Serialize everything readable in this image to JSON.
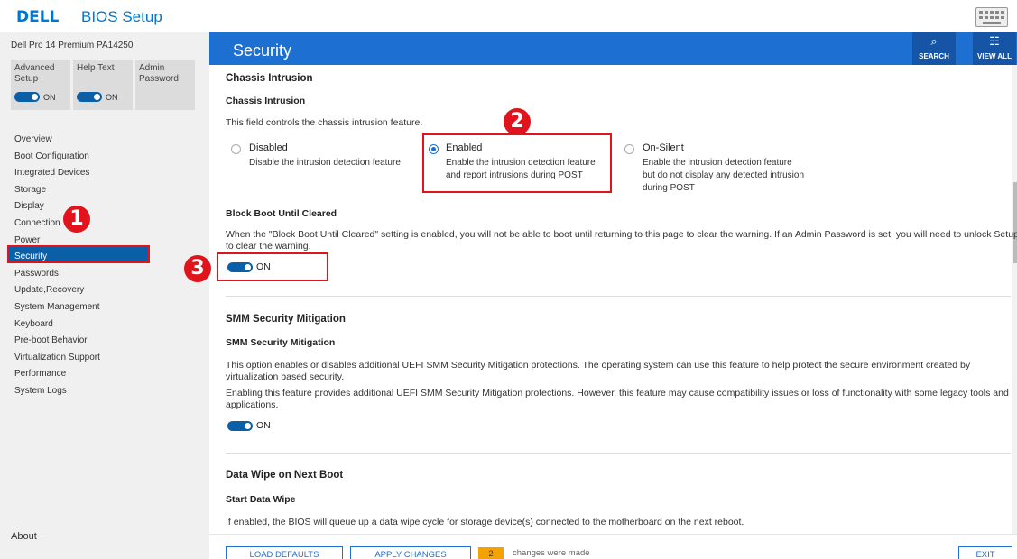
{
  "app": {
    "logo": "DELL",
    "title": "BIOS Setup"
  },
  "sidebar": {
    "model": "Dell Pro 14 Premium PA14250",
    "options": [
      {
        "label": "Advanced Setup",
        "toggle": "ON"
      },
      {
        "label": "Help Text",
        "toggle": "ON"
      },
      {
        "label": "Admin Password"
      }
    ],
    "nav": [
      "Overview",
      "Boot Configuration",
      "Integrated Devices",
      "Storage",
      "Display",
      "Connection",
      "Power",
      "Security",
      "Passwords",
      "Update,Recovery",
      "System Management",
      "Keyboard",
      "Pre-boot Behavior",
      "Virtualization Support",
      "Performance",
      "System Logs"
    ],
    "active": "Security",
    "about": "About"
  },
  "header": {
    "title": "Security",
    "search_label": "SEARCH",
    "view_all_label": "VIEW ALL"
  },
  "main": {
    "chassis": {
      "section": "Chassis Intrusion",
      "sub": "Chassis Intrusion",
      "desc": "This field controls the chassis intrusion feature.",
      "options": [
        {
          "title": "Disabled",
          "desc1": "Disable the intrusion detection feature",
          "desc2": "",
          "desc3": "",
          "selected": false
        },
        {
          "title": "Enabled",
          "desc1": "Enable the intrusion detection feature",
          "desc2": "and report intrusions during POST",
          "desc3": "",
          "selected": true
        },
        {
          "title": "On-Silent",
          "desc1": "Enable the intrusion detection feature",
          "desc2": "but do not display any detected intrusion",
          "desc3": "during POST",
          "selected": false
        }
      ]
    },
    "block_boot": {
      "sub": "Block Boot Until Cleared",
      "desc1": "When the \"Block Boot Until Cleared\" setting is enabled, you will not be able to boot until returning to this page to clear the warning. If an Admin Password is set, you will need to unlock Setup",
      "desc2": "to clear the warning.",
      "toggle": "ON"
    },
    "smm": {
      "section": "SMM Security Mitigation",
      "sub": "SMM Security Mitigation",
      "desc1": "This option enables or disables additional UEFI SMM Security Mitigation protections. The operating system can use this feature to help protect the secure environment created by",
      "desc2": "virtualization based security.",
      "desc3": "Enabling this feature provides additional UEFI SMM Security Mitigation protections. However, this feature may cause compatibility issues or loss of functionality with some legacy tools and",
      "desc4": "applications.",
      "toggle": "ON"
    },
    "data_wipe": {
      "section": "Data Wipe on Next Boot",
      "sub": "Start Data Wipe",
      "desc": "If enabled, the BIOS will queue up a data wipe cycle for storage device(s) connected to the motherboard on the next reboot."
    }
  },
  "footer": {
    "load_defaults": "LOAD DEFAULTS",
    "apply_changes": "APPLY CHANGES",
    "change_count": "2",
    "changes_text": "changes were made",
    "exit": "EXIT"
  },
  "callouts": [
    "1",
    "2",
    "3"
  ],
  "colors": {
    "accent": "#1e6fd2",
    "callout": "#e1131c",
    "badge": "#f3a300"
  }
}
